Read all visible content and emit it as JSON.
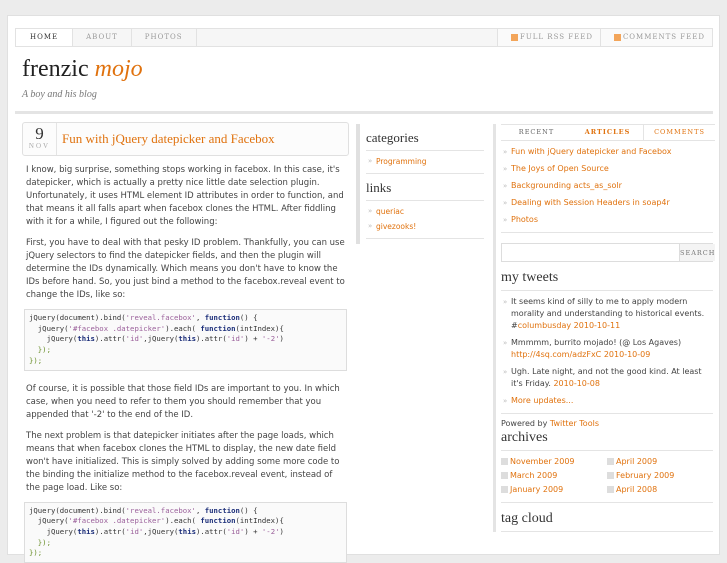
{
  "nav": {
    "items": [
      "HOME",
      "ABOUT",
      "PHOTOS"
    ],
    "feeds": [
      "FULL RSS FEED",
      "COMMENTS FEED"
    ]
  },
  "blog": {
    "title_plain": "frenzic",
    "title_em": "mojo",
    "tagline": "A boy and his blog"
  },
  "post": {
    "day": "9",
    "month": "NOV",
    "title": "Fun with jQuery datepicker and Facebox",
    "p1": "I know, big surprise, something stops working in facebox. In this case, it's datepicker, which is actually a pretty nice little date selection plugin. Unfortunately, it uses HTML element ID attributes in order to function, and that means it all falls apart when facebox clones the HTML. After fiddling with it for a while, I figured out the following:",
    "p2": "First, you have to deal with that pesky ID problem. Thankfully, you can use jQuery selectors to find the datepicker fields, and then the plugin will determine the IDs dynamically. Which means you don't have to know the IDs before hand. So, you just bind a method to the facebox.reveal event to change the IDs, like so:",
    "p3": "Of course, it is possible that those field IDs are important to you. In which case, when you need to refer to them you should remember that you appended that '-2' to the end of the ID.",
    "p4": "The next problem is that datepicker initiates after the page loads, which means that when facebox clones the HTML to display, the new date field won't have initialized. This is simply solved by adding some more code to the binding the initialize method to the facebox.reveal event, instead of the page load. Like so:",
    "code": {
      "a": "jQuery(document).bind(",
      "s1": "'reveal.facebox'",
      ",": ", ",
      "fn": "function",
      "b": "() {",
      "c": "  jQuery(",
      "s2": "'#facebox .datepicker'",
      "d": ").each( ",
      "e": "(intIndex){",
      "f": "    jQuery(",
      "th": "this",
      "g": ").attr(",
      "s3": "'id'",
      "h": ",jQuery(",
      "i": ").attr(",
      "j": ") + ",
      "s4": "'-2'",
      "k": ")",
      "l": "  });",
      "m": "});"
    }
  },
  "categories": {
    "title": "categories",
    "items": [
      "Programming"
    ]
  },
  "links": {
    "title": "links",
    "items": [
      "queriac",
      "givezooks!"
    ]
  },
  "tabs": [
    "RECENT",
    "ARTICLES",
    "COMMENTS"
  ],
  "recent": [
    "Fun with jQuery datepicker and Facebox",
    "The Joys of Open Source",
    "Backgrounding acts_as_solr",
    "Dealing with Session Headers in soap4r",
    "Photos"
  ],
  "search": {
    "button": "SEARCH"
  },
  "tweets": {
    "title": "my tweets",
    "t1": "It seems kind of silly to me to apply modern morality and understanding to historical events. #",
    "t1_link": "columbusday",
    "t1_date": "2010-10-11",
    "t2": "Mmmmm, burrito mojado! (@ Los Agaves) ",
    "t2_link": "http://4sq.com/adzFxC",
    "t2_date": "2010-10-09",
    "t3": "Ugh. Late night, and not the good kind. At least it's Friday. ",
    "t3_date": "2010-10-08",
    "more": "More updates...",
    "powered": "Powered by ",
    "powered_link": "Twitter Tools"
  },
  "archives": {
    "title": "archives",
    "items": [
      "November 2009",
      "April 2009",
      "March 2009",
      "February 2009",
      "January 2009",
      "April 2008"
    ]
  },
  "tagcloud": {
    "title": "tag cloud"
  }
}
